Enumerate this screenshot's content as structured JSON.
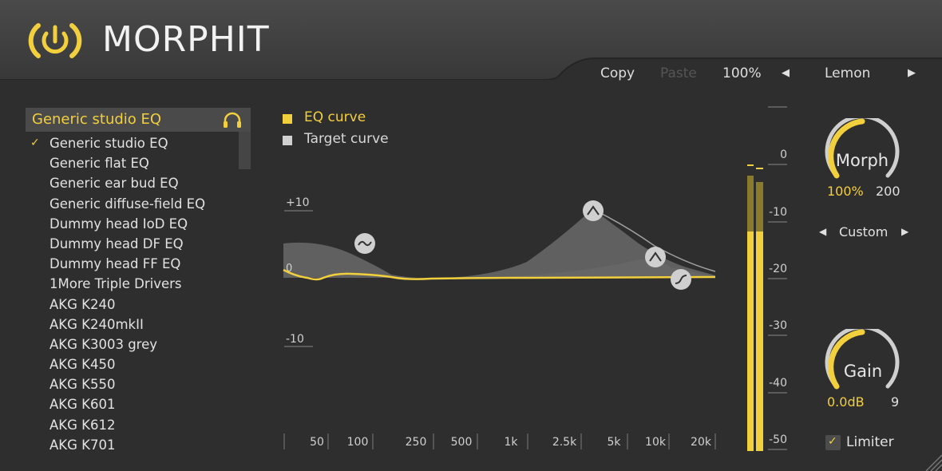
{
  "app": {
    "title": "MORPHIT"
  },
  "toolbar": {
    "copy_label": "Copy",
    "paste_label": "Paste",
    "zoom": "100%",
    "prev_arrow": "◀",
    "next_arrow": "▶",
    "theme": "Lemon"
  },
  "presets": {
    "header": "Generic studio EQ",
    "items": [
      {
        "label": "Generic studio EQ",
        "checked": true
      },
      {
        "label": "Generic flat EQ"
      },
      {
        "label": "Generic ear bud EQ"
      },
      {
        "label": "Generic diffuse-field EQ"
      },
      {
        "label": "Dummy head IoD EQ"
      },
      {
        "label": "Dummy head DF EQ"
      },
      {
        "label": "Dummy head FF EQ"
      },
      {
        "label": "1More Triple Drivers"
      },
      {
        "label": "AKG K240"
      },
      {
        "label": "AKG K240mkII"
      },
      {
        "label": "AKG K3003 grey"
      },
      {
        "label": "AKG K450"
      },
      {
        "label": "AKG K550"
      },
      {
        "label": "AKG K601"
      },
      {
        "label": "AKG K612"
      },
      {
        "label": "AKG K701"
      }
    ],
    "check_glyph": "✓"
  },
  "legend": {
    "eq_curve": "EQ curve",
    "target_curve": "Target curve"
  },
  "graph": {
    "plus_label": "+10",
    "zero_label": "0",
    "minus_label": "-10",
    "freq_labels": [
      "50",
      "100",
      "250",
      "500",
      "1k",
      "2.5k",
      "5k",
      "10k",
      "20k"
    ]
  },
  "meter": {
    "scale_labels": [
      "0",
      "-10",
      "-20",
      "-30",
      "-40",
      "-50"
    ]
  },
  "morph": {
    "label": "Morph",
    "value": "100%",
    "max": "200",
    "level": 1.0
  },
  "mode": {
    "prev": "◀",
    "label": "Custom",
    "next": "▶"
  },
  "gain": {
    "label": "Gain",
    "value": "0.0dB",
    "max": "9"
  },
  "limiter": {
    "label": "Limiter",
    "checked": true,
    "check_glyph": "✓"
  },
  "colors": {
    "accent": "#f2cf3d",
    "background": "#2e2e2e",
    "header": "#3a3a3a",
    "target": "#d0d0d0"
  }
}
